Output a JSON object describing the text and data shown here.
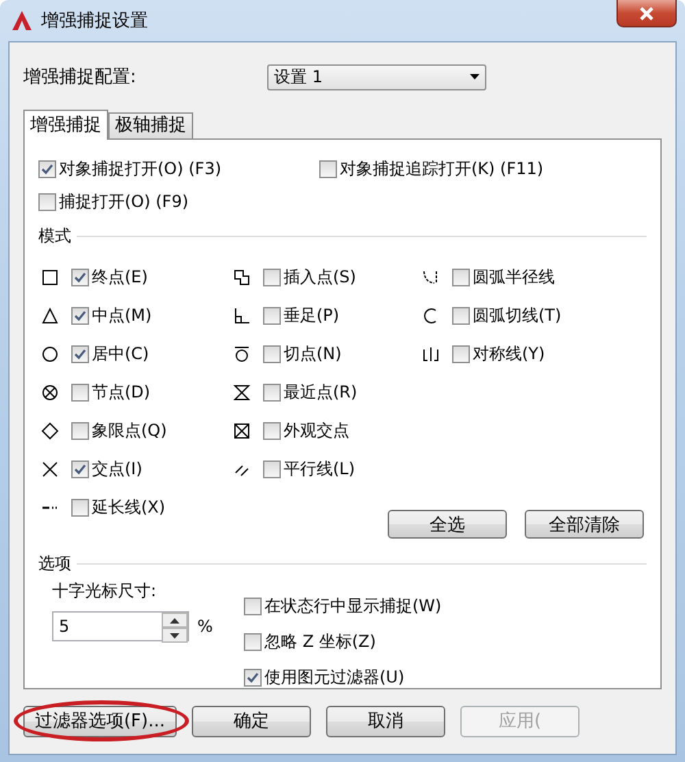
{
  "window": {
    "title": "增强捕捉设置"
  },
  "config": {
    "label": "增强捕捉配置:",
    "value": "设置 1"
  },
  "tabs": [
    {
      "label": "增强捕捉",
      "selected": true
    },
    {
      "label": "极轴捕捉",
      "selected": false
    }
  ],
  "toggles": [
    {
      "label": "对象捕捉打开(O) (F3)",
      "checked": true
    },
    {
      "label": "对象捕捉追踪打开(K) (F11)",
      "checked": false
    },
    {
      "label": "捕捉打开(O) (F9)",
      "checked": false
    }
  ],
  "modes": {
    "title": "模式",
    "columns": [
      {
        "items": [
          {
            "kind": "square",
            "label": "终点(E)",
            "checked": true
          },
          {
            "kind": "triangle",
            "label": "中点(M)",
            "checked": true
          },
          {
            "kind": "circle",
            "label": "居中(C)",
            "checked": true
          },
          {
            "kind": "node",
            "label": "节点(D)",
            "checked": false
          },
          {
            "kind": "diamond",
            "label": "象限点(Q)",
            "checked": false
          },
          {
            "kind": "cross",
            "label": "交点(I)",
            "checked": true
          },
          {
            "kind": "extension",
            "label": "延长线(X)",
            "checked": false
          }
        ]
      },
      {
        "items": [
          {
            "kind": "insertion",
            "label": "插入点(S)",
            "checked": false
          },
          {
            "kind": "perpendicular",
            "label": "垂足(P)",
            "checked": false
          },
          {
            "kind": "tangent",
            "label": "切点(N)",
            "checked": false
          },
          {
            "kind": "nearest",
            "label": "最近点(R)",
            "checked": false
          },
          {
            "kind": "apparent",
            "label": "外观交点",
            "checked": false
          },
          {
            "kind": "parallel",
            "label": "平行线(L)",
            "checked": false
          }
        ]
      },
      {
        "items": [
          {
            "kind": "arcradius",
            "label": "圆弧半径线",
            "checked": false
          },
          {
            "kind": "arctangent",
            "label": "圆弧切线(T)",
            "checked": false
          },
          {
            "kind": "symmetric",
            "label": "对称线(Y)",
            "checked": false
          }
        ]
      }
    ],
    "buttons": [
      "全选",
      "全部清除"
    ]
  },
  "options": {
    "title": "选项",
    "cursor_label": "十字光标尺寸:",
    "cursor_value": "5",
    "unit": "%",
    "checks": [
      {
        "label": "在状态行中显示捕捉(W)",
        "checked": false
      },
      {
        "label": "忽略 Z 坐标(Z)",
        "checked": false
      },
      {
        "label": "使用图元过滤器(U)",
        "checked": true
      }
    ]
  },
  "footer_buttons": [
    {
      "label": "过滤器选项(F)...",
      "disabled": false,
      "circled": true
    },
    {
      "label": "确定",
      "disabled": false,
      "circled": false
    },
    {
      "label": "取消",
      "disabled": false,
      "circled": false
    },
    {
      "label": "应用(",
      "disabled": true,
      "circled": false
    }
  ]
}
